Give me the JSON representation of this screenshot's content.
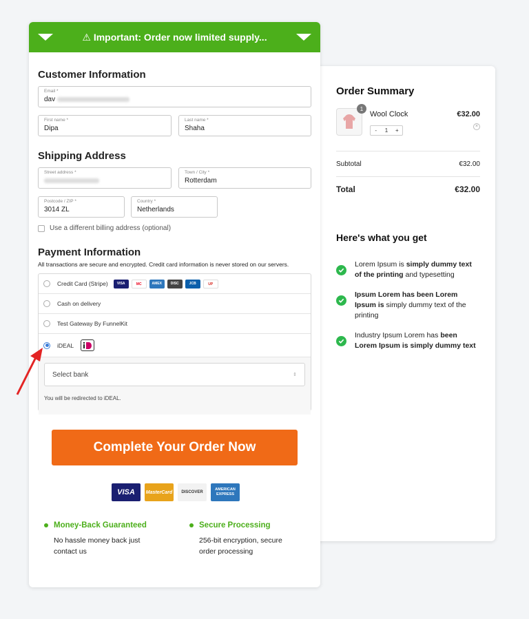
{
  "banner": {
    "text": "⚠ Important: Order now limited supply..."
  },
  "customer": {
    "title": "Customer Information",
    "email": {
      "label": "Email *",
      "value": "dav"
    },
    "first_name": {
      "label": "First name *",
      "value": "Dipa"
    },
    "last_name": {
      "label": "Last name *",
      "value": "Shaha"
    }
  },
  "shipping": {
    "title": "Shipping Address",
    "street": {
      "label": "Street address *",
      "value": ""
    },
    "city": {
      "label": "Town / City *",
      "value": "Rotterdam"
    },
    "postcode": {
      "label": "Postcode / ZIP *",
      "value": "3014 ZL"
    },
    "country": {
      "label": "Country *",
      "value": "Netherlands"
    },
    "billing_checkbox": "Use a different billing address (optional)"
  },
  "payment": {
    "title": "Payment Information",
    "note": "All transactions are secure and encrypted. Credit card information is never stored on our servers.",
    "options": [
      {
        "label": "Credit Card (Stripe)",
        "selected": false
      },
      {
        "label": "Cash on delivery",
        "selected": false
      },
      {
        "label": "Test Gateway By FunnelKit",
        "selected": false
      },
      {
        "label": "iDEAL",
        "selected": true
      }
    ],
    "card_logos": [
      "VISA",
      "MC",
      "AMEX",
      "DISC",
      "JCB",
      "UP"
    ],
    "select_bank": "Select bank",
    "redirect_note": "You will be redirected to iDEAL."
  },
  "cta": {
    "label": "Complete Your Order Now"
  },
  "trust_logos": [
    "VISA",
    "MasterCard",
    "DISCOVER",
    "AMERICAN EXPRESS"
  ],
  "guarantees": [
    {
      "title": "Money-Back Guaranteed",
      "desc": "No hassle money back just contact us"
    },
    {
      "title": "Secure Processing",
      "desc": "256-bit encryption, secure order processing"
    }
  ],
  "summary": {
    "title": "Order Summary",
    "product": {
      "name": "Wool Clock",
      "qty": "1",
      "badge": "1",
      "price": "€32.00",
      "minus": "-",
      "plus": "+"
    },
    "subtotal_label": "Subtotal",
    "subtotal": "€32.00",
    "total_label": "Total",
    "total": "€32.00"
  },
  "benefits": {
    "title": "Here's what you get",
    "items": [
      {
        "a": "Lorem Ipsum is ",
        "b": "simply dummy text of the printing",
        "c": " and typesetting"
      },
      {
        "a": "",
        "b": "Ipsum Lorem has been Lorem Ipsum is",
        "c": " simply dummy text of the printing"
      },
      {
        "a": "Industry Ipsum Lorem has ",
        "b": "been Lorem Ipsum is simply dummy text",
        "c": ""
      }
    ]
  },
  "colors": {
    "brand_green": "#4caf1b",
    "cta_orange": "#f06a17",
    "check_green": "#2db84d"
  }
}
